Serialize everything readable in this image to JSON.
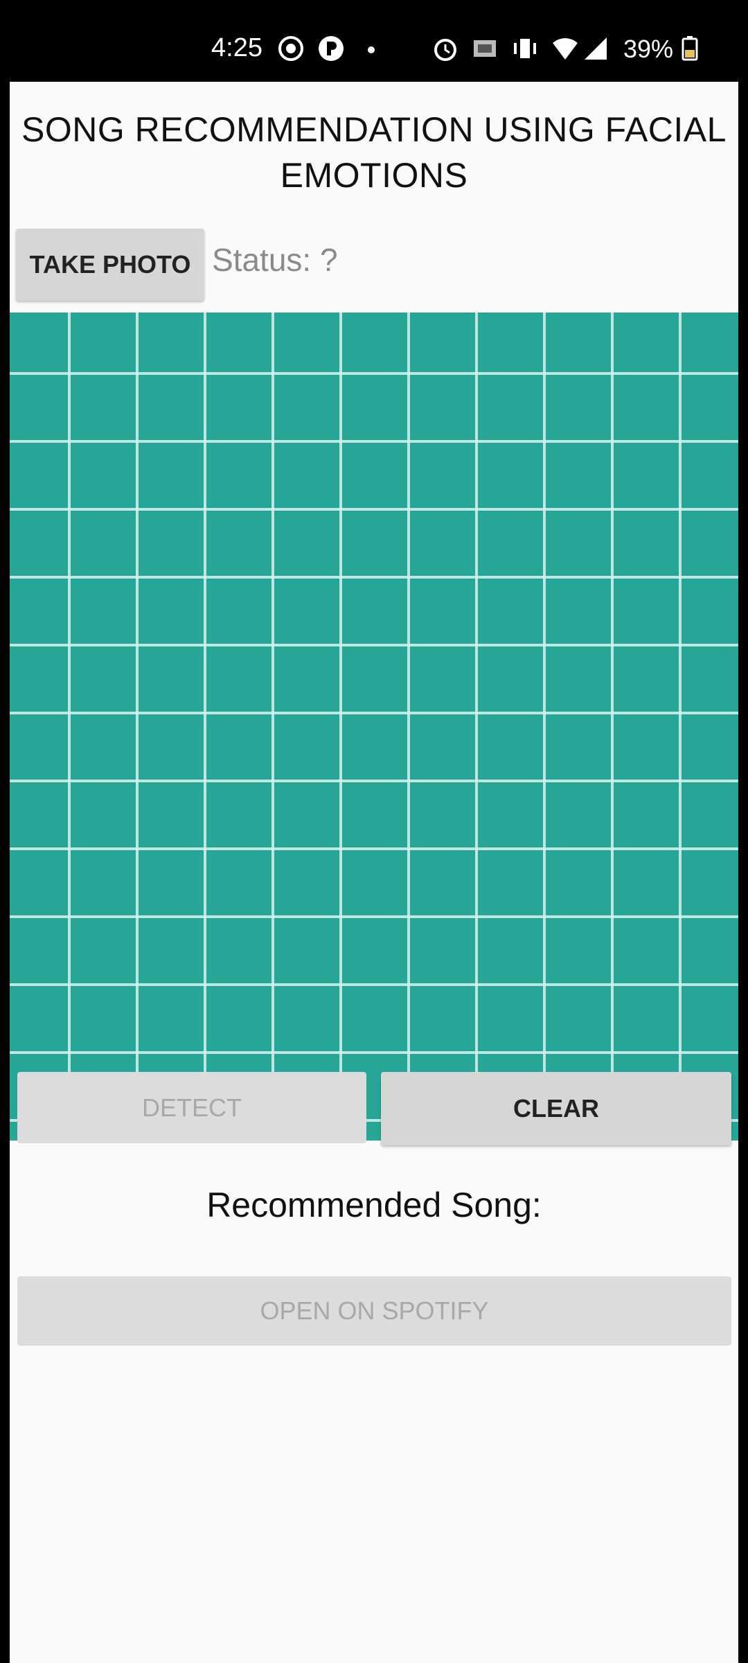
{
  "status_bar": {
    "time": "4:25",
    "battery": "39%",
    "icons": [
      "whatsapp-icon",
      "app-icon",
      "dot-icon",
      "alarm-icon",
      "cast-icon",
      "vibrate-icon",
      "wifi-icon",
      "signal-icon",
      "battery-icon"
    ]
  },
  "app": {
    "title_line1": "SONG RECOMMENDATION USING FACIAL",
    "title_line2": "EMOTIONS",
    "take_photo_label": "TAKE PHOTO",
    "status_text": "Status: ?",
    "detect_label": "DETECT",
    "clear_label": "CLEAR",
    "recommended_label": "Recommended Song:",
    "spotify_label": "OPEN ON SPOTIFY"
  },
  "colors": {
    "image_background": "#27a596",
    "grid_line": "#d8f3ef"
  }
}
